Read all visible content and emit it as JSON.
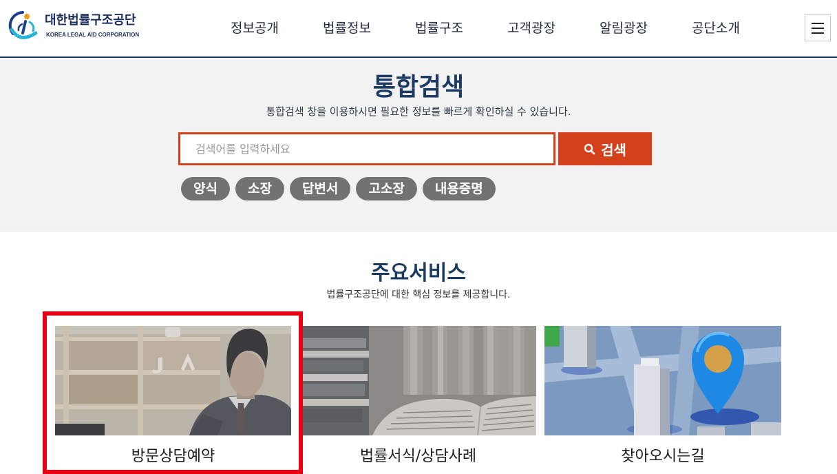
{
  "header": {
    "logo": {
      "title": "대한법률구조공단",
      "subtitle": "KOREA LEGAL AID CORPORATION"
    },
    "nav": [
      {
        "label": "정보공개"
      },
      {
        "label": "법률정보"
      },
      {
        "label": "법률구조"
      },
      {
        "label": "고객광장"
      },
      {
        "label": "알림광장"
      },
      {
        "label": "공단소개"
      }
    ],
    "menu_icon": "hamburger-icon"
  },
  "search": {
    "title": "통합검색",
    "description": "통합검색 창을 이용하시면 필요한 정보를 빠르게 확인하실 수 있습니다.",
    "input": {
      "placeholder": "검색어를 입력하세요",
      "value": ""
    },
    "button": {
      "label": "검색",
      "icon": "search-icon"
    },
    "tags": [
      "양식",
      "소장",
      "답변서",
      "고소장",
      "내용증명"
    ]
  },
  "services": {
    "title": "주요서비스",
    "description": "법률구조공단에 대한 핵심 정보를 제공합니다.",
    "items": [
      {
        "label": "방문상담예약",
        "highlighted": true
      },
      {
        "label": "법률서식/상담사례"
      },
      {
        "label": "찾아오시는길"
      }
    ]
  },
  "colors": {
    "navy": "#1b3b63",
    "accent": "#d4401b",
    "tag": "#727272",
    "highlight": "#e60012",
    "search_bg": "#f2f2f2"
  }
}
